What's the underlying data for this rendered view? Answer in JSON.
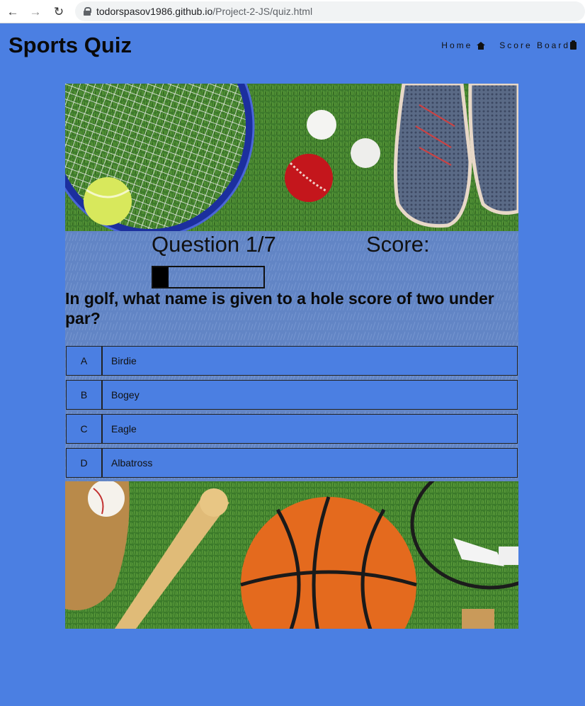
{
  "browser": {
    "url_host": "todorspasov1986.github.io",
    "url_path": "/Project-2-JS/quiz.html"
  },
  "site": {
    "title": "Sports Quiz",
    "nav": [
      {
        "label": "Home",
        "icon": "home-icon"
      },
      {
        "label": "Score Board",
        "icon": "clipboard-icon"
      }
    ]
  },
  "quiz": {
    "question_counter": "Question 1/7",
    "score_label": "Score:",
    "progress": 0.14,
    "question": "In golf, what name is given to a hole score of two under par?",
    "answers": [
      {
        "letter": "A",
        "text": "Birdie"
      },
      {
        "letter": "B",
        "text": "Bogey"
      },
      {
        "letter": "C",
        "text": "Eagle"
      },
      {
        "letter": "D",
        "text": "Albatross"
      }
    ]
  },
  "colors": {
    "background": "#4b7fe2",
    "grass": "#3f7a2b"
  }
}
